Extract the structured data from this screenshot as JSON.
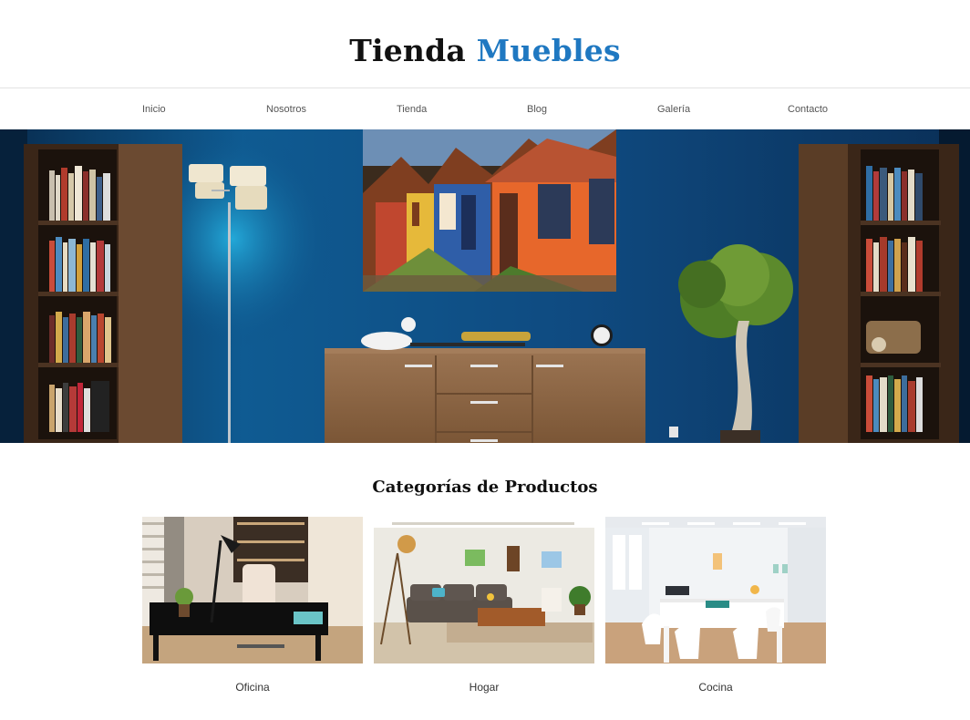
{
  "brand": {
    "part1": "Tienda",
    "part2": "Muebles",
    "accent_color": "#1f78c1"
  },
  "nav": {
    "items": [
      {
        "label": "Inicio"
      },
      {
        "label": "Nosotros"
      },
      {
        "label": "Tienda"
      },
      {
        "label": "Blog"
      },
      {
        "label": "Galería"
      },
      {
        "label": "Contacto"
      }
    ]
  },
  "hero": {
    "image": "living-room-blue-wall-photo"
  },
  "categories": {
    "title": "Categorías de Productos",
    "items": [
      {
        "label": "Oficina",
        "image": "office-desk-photo"
      },
      {
        "label": "Hogar",
        "image": "living-room-sofa-photo"
      },
      {
        "label": "Cocina",
        "image": "white-dining-table-photo"
      }
    ]
  }
}
